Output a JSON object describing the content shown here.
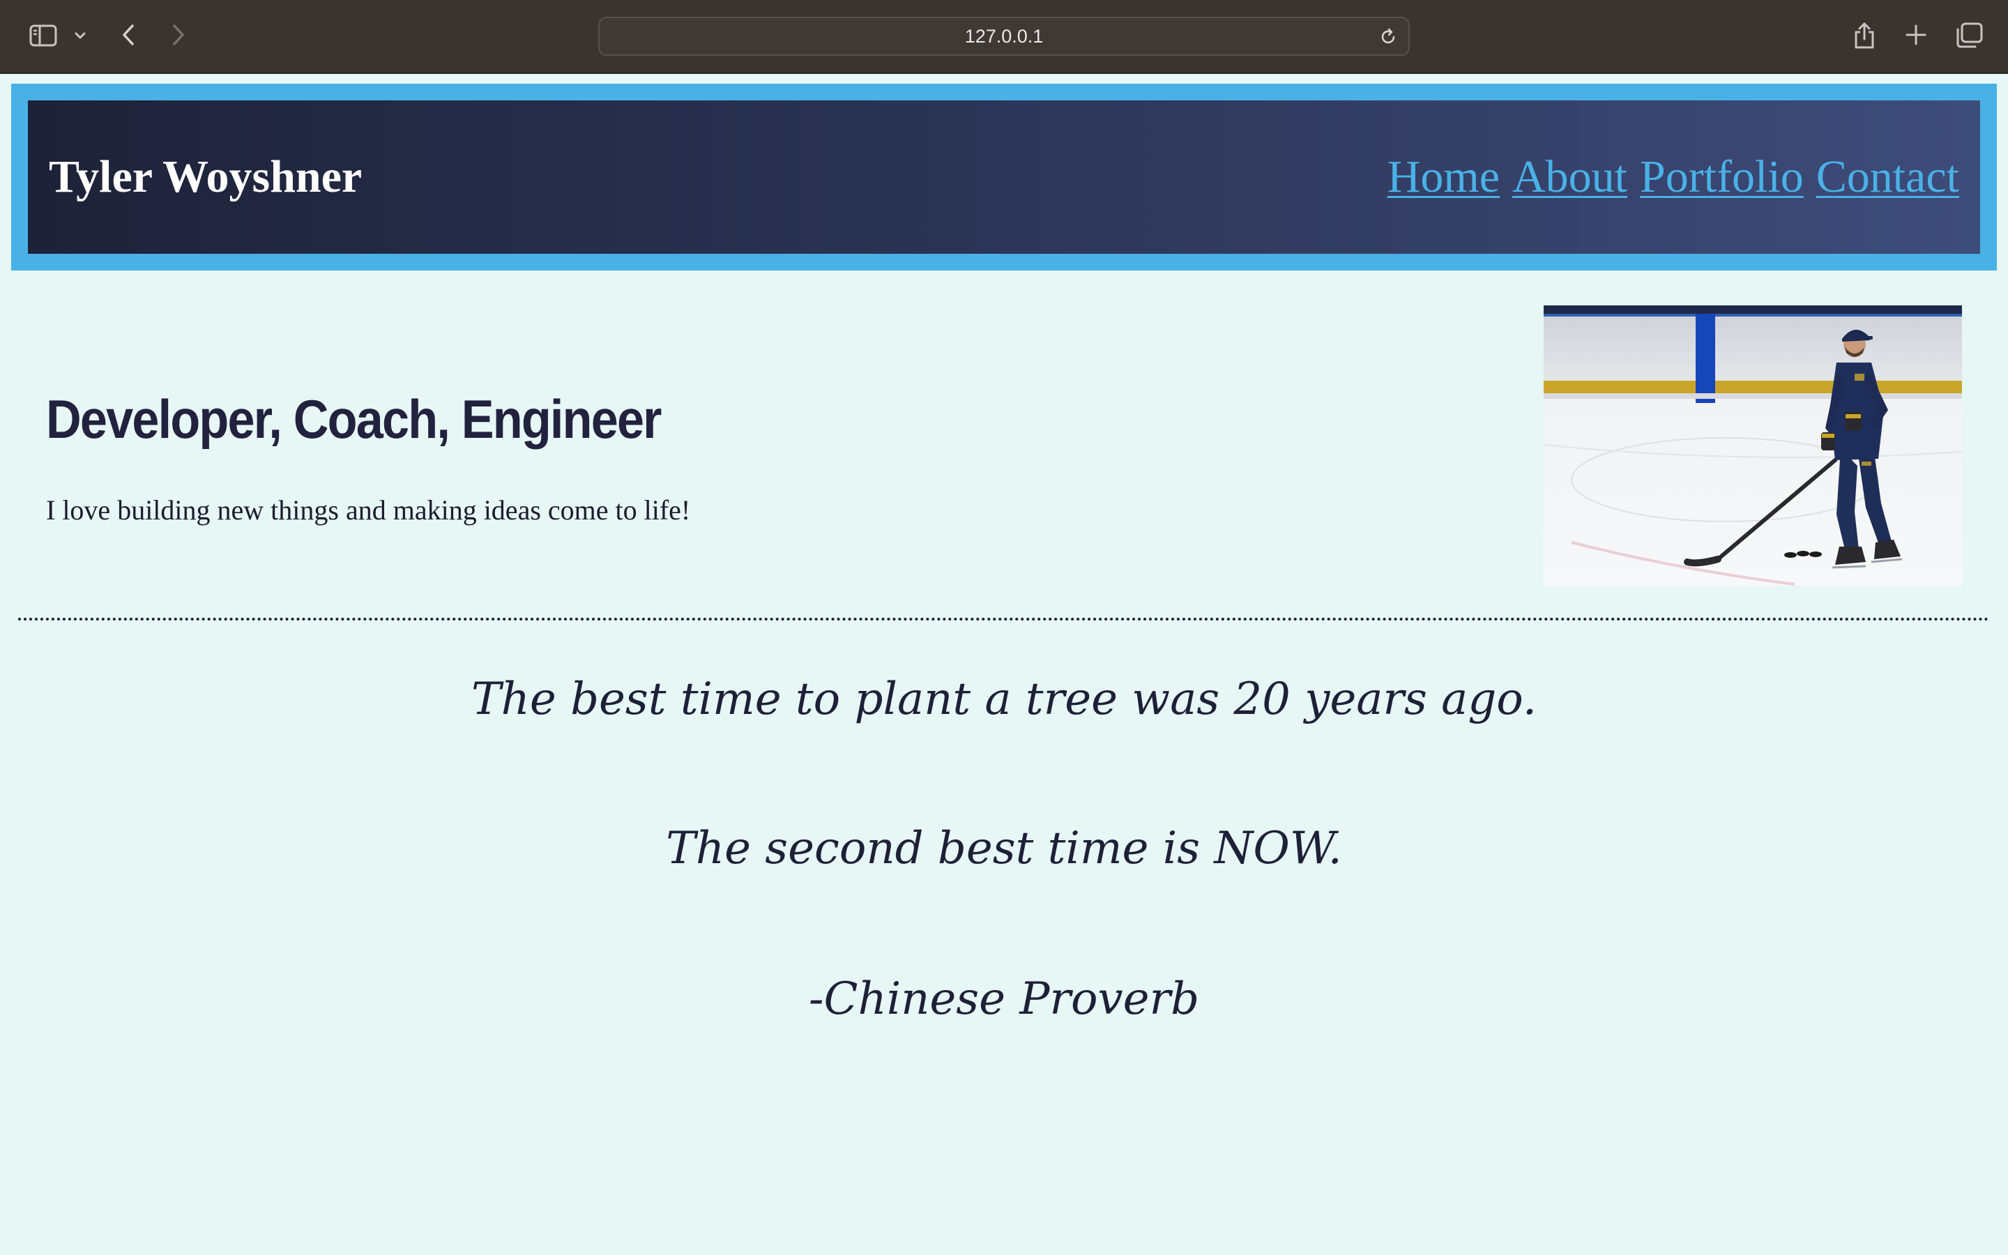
{
  "browser": {
    "address": "127.0.0.1"
  },
  "header": {
    "site_title": "Tyler Woyshner",
    "nav": [
      {
        "label": "Home"
      },
      {
        "label": "About"
      },
      {
        "label": "Portfolio"
      },
      {
        "label": "Contact"
      }
    ],
    "colors": {
      "border": "#4ab1e6",
      "link": "#4ab1e6",
      "gradient_start": "#1e2238",
      "gradient_end": "#3e4c7a"
    }
  },
  "hero": {
    "heading": "Developer, Coach, Engineer",
    "tagline": "I love building new things and making ideas come to life!",
    "photo": "hockey-coach-on-ice-photo"
  },
  "quote": {
    "line1": "The best time to plant a tree was 20 years ago.",
    "line2": "The second best time is NOW.",
    "author": "-Chinese Proverb"
  },
  "page": {
    "background": "#e6f7f6",
    "text_color": "#1e2038"
  }
}
